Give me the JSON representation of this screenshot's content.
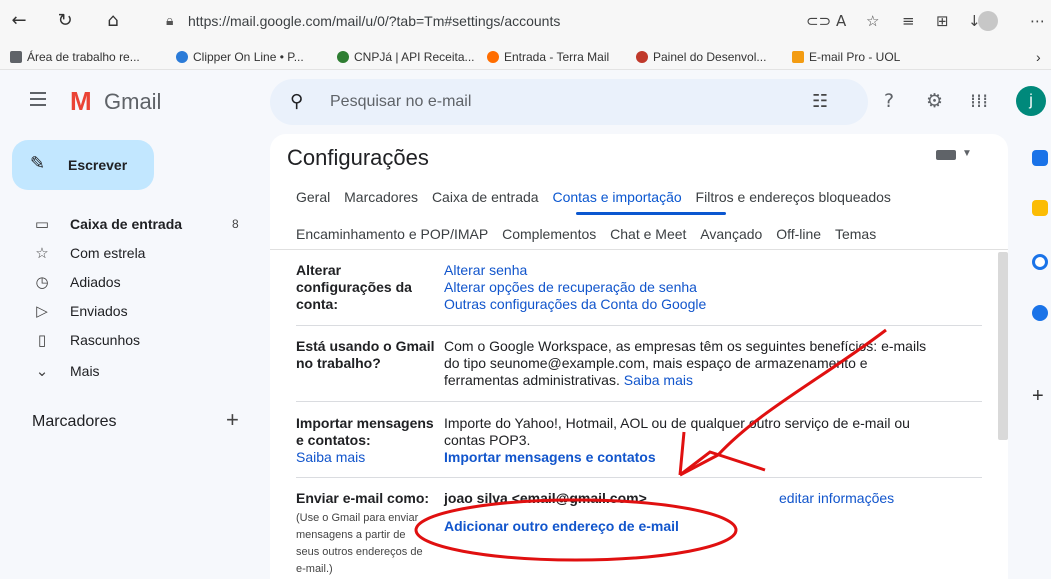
{
  "browser": {
    "url": "https://mail.google.com/mail/u/0/?tab=Tm#settings/accounts",
    "bookmarks": [
      {
        "label": "Área de trabalho re...",
        "color": "#5f6368"
      },
      {
        "label": "Clipper On Line • P...",
        "color": "#2b7bd8"
      },
      {
        "label": "CNPJá | API Receita...",
        "color": "#2e7d32"
      },
      {
        "label": "Entrada - Terra Mail",
        "color": "#ff6d00"
      },
      {
        "label": "Painel do Desenvol...",
        "color": "#c0392b"
      },
      {
        "label": "E-mail Pro - UOL",
        "color": "#f39c12"
      }
    ]
  },
  "header": {
    "logo_letter": "M",
    "app_name": "Gmail",
    "search_placeholder": "Pesquisar no e-mail",
    "account_initial": "j"
  },
  "sidebar": {
    "compose_label": "Escrever",
    "items": [
      {
        "label": "Caixa de entrada",
        "count": "8",
        "icon": "inbox-icon"
      },
      {
        "label": "Com estrela",
        "icon": "star-icon"
      },
      {
        "label": "Adiados",
        "icon": "clock-icon"
      },
      {
        "label": "Enviados",
        "icon": "send-icon"
      },
      {
        "label": "Rascunhos",
        "icon": "draft-icon"
      },
      {
        "label": "Mais",
        "icon": "chevron-down-icon"
      }
    ],
    "labels_heading": "Marcadores"
  },
  "settings": {
    "title": "Configurações",
    "tabs_row1": [
      "Geral",
      "Marcadores",
      "Caixa de entrada",
      "Contas e importação",
      "Filtros e endereços bloqueados"
    ],
    "tabs_row2": [
      "Encaminhamento e POP/IMAP",
      "Complementos",
      "Chat e Meet",
      "Avançado",
      "Off-line",
      "Temas"
    ],
    "active_tab": "Contas e importação",
    "sections": {
      "account": {
        "label_1": "Alterar",
        "label_2": "configurações da",
        "label_3": "conta:",
        "links": [
          "Alterar senha",
          "Alterar opções de recuperação de senha",
          "Outras configurações da Conta do Google"
        ]
      },
      "workspace": {
        "label_1": "Está usando o Gmail",
        "label_2": "no trabalho?",
        "line_1": "Com o Google Workspace, as empresas têm os seguintes benefícios: e-mails",
        "line_2": "do tipo seunome@example.com, mais espaço de armazenamento e",
        "line_3": "ferramentas administrativas.",
        "link": "Saiba mais"
      },
      "import": {
        "label_1": "Importar mensagens",
        "label_2": "e contatos:",
        "label_link": "Saiba mais",
        "line_1": "Importe do Yahoo!, Hotmail, AOL ou de qualquer outro serviço de e-mail ou",
        "line_2": "contas POP3.",
        "action": "Importar mensagens e contatos"
      },
      "send_as": {
        "label": "Enviar e-mail como:",
        "help_1": "(Use o Gmail para enviar",
        "help_2": "mensagens a partir de",
        "help_3": "seus outros endereços de",
        "help_4": "e-mail.)",
        "address": "joao silva <email@gmail.com>",
        "edit_link": "editar informações",
        "add_link": "Adicionar outro endereço de e-mail"
      }
    }
  },
  "colors": {
    "accent": "#0b57d0",
    "annotation": "#e01010",
    "compose_bg": "#c2e7ff"
  }
}
